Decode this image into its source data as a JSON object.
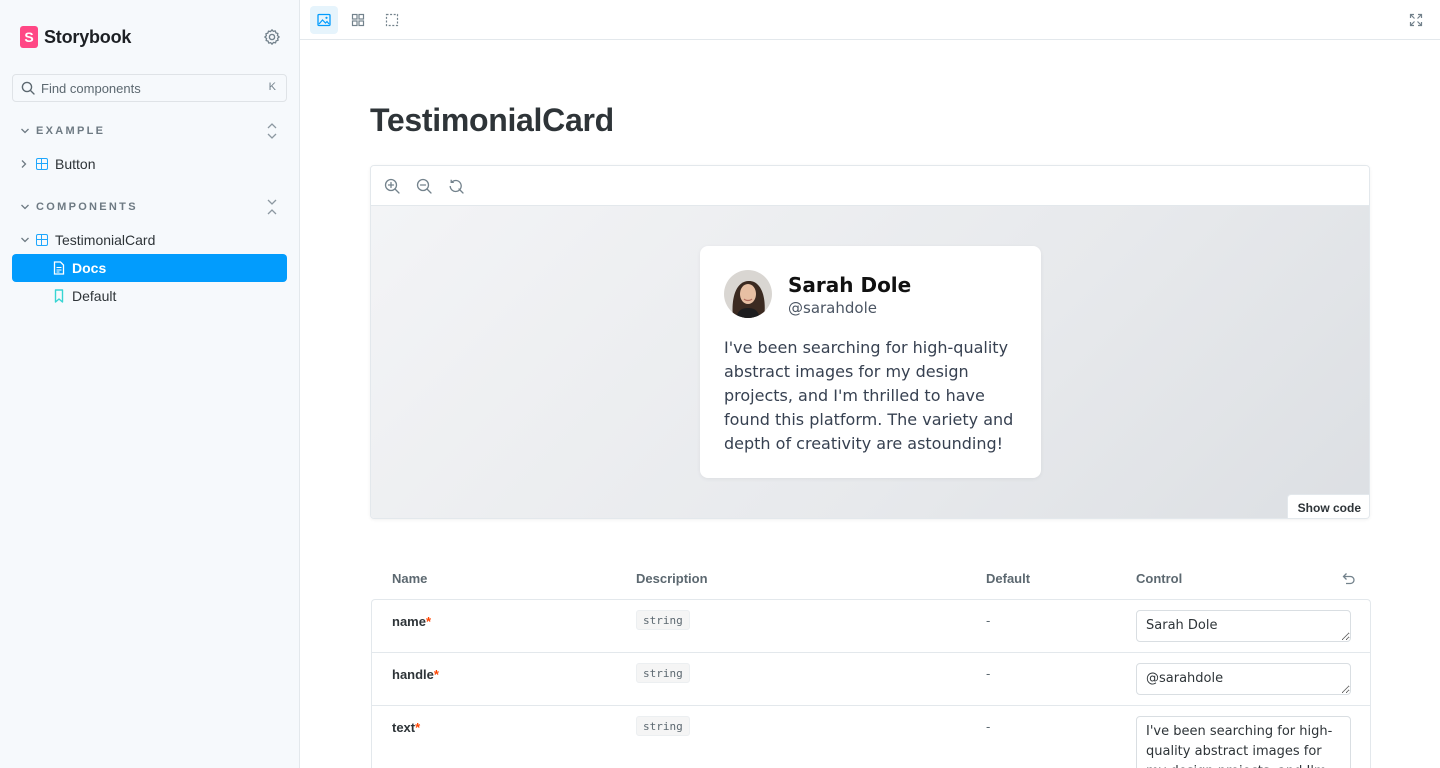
{
  "app": {
    "brand_glyph": "S",
    "brand_name": "Storybook",
    "accent": "#029cfd",
    "brand_color": "#ff4785"
  },
  "sidebar": {
    "search_placeholder": "Find components",
    "search_shortcut": "K",
    "sections": [
      {
        "label": "EXAMPLE",
        "items": [
          {
            "label": "Button",
            "icon": "component-icon"
          }
        ]
      },
      {
        "label": "COMPONENTS",
        "items": [
          {
            "label": "TestimonialCard",
            "icon": "component-icon"
          },
          {
            "label": "Docs",
            "icon": "document-icon",
            "selected": true
          },
          {
            "label": "Default",
            "icon": "bookmark-icon"
          }
        ]
      }
    ]
  },
  "docs": {
    "title": "TestimonialCard",
    "show_code_label": "Show code"
  },
  "card": {
    "name": "Sarah Dole",
    "handle": "@sarahdole",
    "text": "I've been searching for high-quality abstract images for my design projects, and I'm thrilled to have found this platform. The variety and depth of creativity are astounding!"
  },
  "args_table": {
    "headers": {
      "name": "Name",
      "description": "Description",
      "default": "Default",
      "control": "Control"
    },
    "rows": [
      {
        "name": "name",
        "required": "*",
        "type": "string",
        "default": "-",
        "control_value": "Sarah Dole"
      },
      {
        "name": "handle",
        "required": "*",
        "type": "string",
        "default": "-",
        "control_value": "@sarahdole"
      },
      {
        "name": "text",
        "required": "*",
        "type": "string",
        "default": "-",
        "control_value": "I've been searching for high-quality abstract images for my design projects, and I'm thrilled to have found this platform. The variety and depth of creativity are astounding!"
      }
    ]
  }
}
